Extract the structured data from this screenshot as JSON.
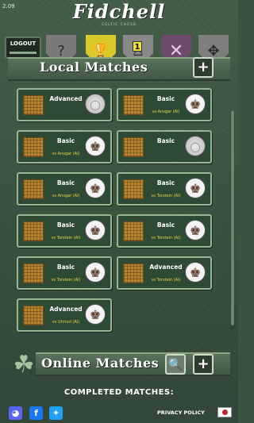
{
  "app": {
    "version": "2.09",
    "title": "Fidchell",
    "subtitle": "CELTIC CHESS"
  },
  "nav": {
    "logout_label": "LOGOUT",
    "icons": [
      "question-icon",
      "trophy-icon",
      "puzzle-icon",
      "crossed-swords-icon",
      "settings-knot-icon"
    ],
    "puzzle_badge": "1"
  },
  "local": {
    "title": "Local Matches",
    "add_label": "+"
  },
  "matches": [
    {
      "level": "Advanced",
      "opponent": "",
      "piece": "empty"
    },
    {
      "level": "Basic",
      "opponent": "vs Ansgar (AI)",
      "piece": "king"
    },
    {
      "level": "Basic",
      "opponent": "vs Ansgar (AI)",
      "piece": "king"
    },
    {
      "level": "Basic",
      "opponent": "",
      "piece": "empty"
    },
    {
      "level": "Basic",
      "opponent": "vs Ansgar (AI)",
      "piece": "king"
    },
    {
      "level": "Basic",
      "opponent": "vs Torstein (AI)",
      "piece": "king"
    },
    {
      "level": "Basic",
      "opponent": "vs Torstein (AI)",
      "piece": "king"
    },
    {
      "level": "Basic",
      "opponent": "vs Torstein (AI)",
      "piece": "king"
    },
    {
      "level": "Basic",
      "opponent": "vs Torstein (AI)",
      "piece": "king"
    },
    {
      "level": "Advanced",
      "opponent": "vs Torstein (AI)",
      "piece": "king"
    },
    {
      "level": "Advanced",
      "opponent": "vs Uhtred (AI)",
      "piece": "king"
    }
  ],
  "online": {
    "title": "Online Matches",
    "add_label": "+"
  },
  "completed_label": "COMPLETED MATCHES:",
  "footer": {
    "privacy_label": "PRIVACY POLICY",
    "social": [
      "discord-icon",
      "facebook-icon",
      "twitter-icon"
    ]
  },
  "colors": {
    "background": "#3d5340",
    "tile_border": "#9ab593",
    "opponent_text": "#f0d34a"
  }
}
